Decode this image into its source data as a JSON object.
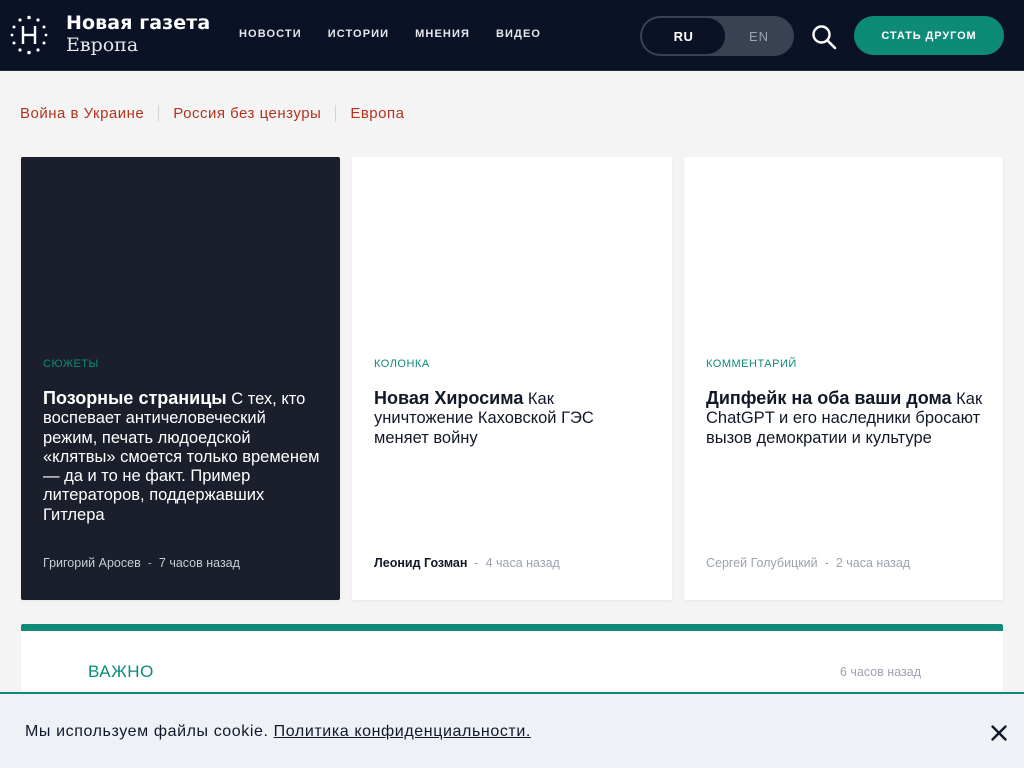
{
  "header": {
    "logo": {
      "line1": "Новая газета",
      "line2": "Европа",
      "icon": "logo-n-icon"
    },
    "nav": [
      {
        "label": "НОВОСТИ"
      },
      {
        "label": "ИСТОРИИ"
      },
      {
        "label": "МНЕНИЯ"
      },
      {
        "label": "ВИДЕО"
      }
    ],
    "lang": {
      "active": "RU",
      "other": "EN"
    },
    "search_icon": "search-icon",
    "cta_label": "СТАТЬ ДРУГОМ"
  },
  "topics": [
    {
      "label": "Война в Украине"
    },
    {
      "label": "Россия без цензуры"
    },
    {
      "label": "Европа"
    }
  ],
  "cards": [
    {
      "category": "СЮЖЕТЫ",
      "title_bold": "Позорные страницы",
      "title_rest": "С тех, кто воспевает античеловеческий режим, печать людоедской «клятвы» смоется только временем — да и то не факт. Пример литераторов, поддержавших Гитлера",
      "author": "Григорий Аросев",
      "time": "7 часов назад"
    },
    {
      "category": "КОЛОНКА",
      "title_bold": "Новая Хиросима",
      "title_rest": "Как уничтожение Каховской ГЭС меняет войну",
      "author": "Леонид Гозман",
      "time": "4 часа назад"
    },
    {
      "category": "КОММЕНТАРИЙ",
      "title_bold": "Дипфейк на оба ваши дома",
      "title_rest": "Как ChatGPT и его наследники бросают вызов демократии и культуре",
      "author": "Сергей Голубицкий",
      "time": "2 часа назад"
    }
  ],
  "important": {
    "label": "ВАЖНО",
    "time": "6 часов назад"
  },
  "cookie": {
    "text": "Мы используем файлы cookie.",
    "link": "Политика конфиденциальности.",
    "close_icon": "close-icon"
  },
  "colors": {
    "header_bg": "#0c1226",
    "accent": "#0d8b78",
    "topic_link": "#b4331f",
    "dark_card": "#1a1f2b"
  }
}
